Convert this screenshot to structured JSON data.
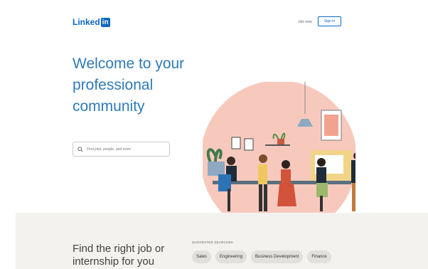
{
  "header": {
    "logo_text": "Linked",
    "logo_badge": "in",
    "join_label": "Join now",
    "signin_label": "Sign in"
  },
  "hero": {
    "headline": "Welcome to your professional community",
    "search_placeholder": "Find jobs, people, and more"
  },
  "jobs_section": {
    "title": "Find the right job or internship for you",
    "suggested_label": "SUGGESTED SEARCHES",
    "chips": [
      "Sales",
      "Engineering",
      "Business Development",
      "Finance"
    ]
  },
  "colors": {
    "brand": "#0a66c2",
    "headline": "#2e7bb6",
    "band": "#f3f2ef",
    "illustration_circle": "#f7c9bd"
  }
}
